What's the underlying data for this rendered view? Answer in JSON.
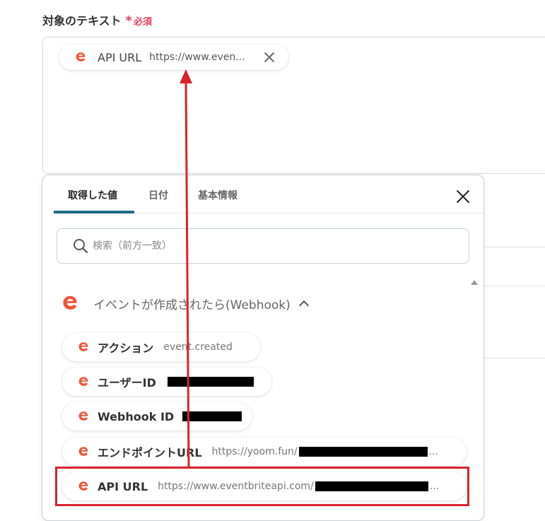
{
  "field": {
    "label": "対象のテキスト",
    "required_star": "*",
    "required_text": "必須"
  },
  "selected_chip": {
    "icon": "eventbrite-logo-icon",
    "key": "API URL",
    "value": "https://www.even...",
    "close_icon": "close-icon"
  },
  "panel": {
    "tabs": [
      {
        "label": "取得した値",
        "active": true
      },
      {
        "label": "日付",
        "active": false
      },
      {
        "label": "基本情報",
        "active": false
      }
    ],
    "search_placeholder": "検索（前方一致）",
    "group": {
      "title": "イベントが作成されたら(Webhook)",
      "expanded": true
    },
    "items": [
      {
        "key": "アクション",
        "value": "event.created",
        "redacted": false
      },
      {
        "key": "ユーザーID",
        "value": "",
        "redacted": true
      },
      {
        "key": "Webhook ID",
        "value": "",
        "redacted": true
      },
      {
        "key": "エンドポイントURL",
        "value": "https://yoom.fun/",
        "value_suffix": "...",
        "redacted": true
      },
      {
        "key": "API URL",
        "value": "https://www.eventbriteapi.com/",
        "value_suffix": "...",
        "redacted": true
      }
    ]
  },
  "colors": {
    "brand_orange": "#f05537",
    "tab_underline": "#1c6c82",
    "required_red": "#e5415a",
    "annotation_red": "#d9232d"
  }
}
